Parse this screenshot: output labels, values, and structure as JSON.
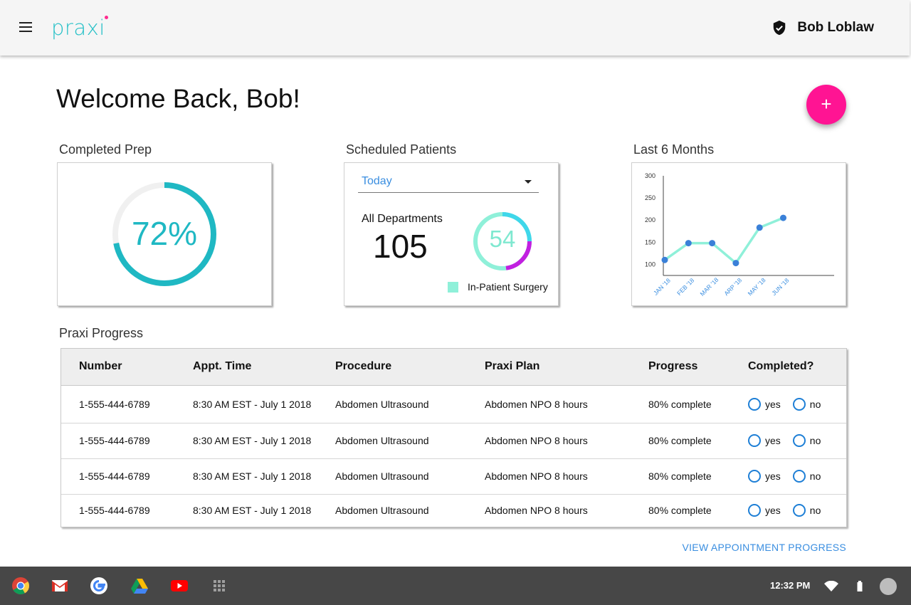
{
  "header": {
    "logo_text": "praxi",
    "user_name": "Bob Loblaw"
  },
  "welcome": {
    "title": "Welcome Back, Bob!"
  },
  "fab": {
    "label": "+"
  },
  "completed_prep": {
    "title": "Completed Prep",
    "value_label": "72%",
    "percent": 72,
    "color": "#1fb8c3"
  },
  "scheduled_patients": {
    "title": "Scheduled Patients",
    "period": "Today",
    "department_label": "All Departments",
    "department_count": "105",
    "ring_value": "54",
    "legend_label": "In-Patient Surgery",
    "colors": {
      "ring": "#8ff0d9",
      "accent_cyan": "#3fd7ea",
      "accent_purple": "#c21fe0"
    }
  },
  "last_months": {
    "title": "Last 6 Months"
  },
  "chart_data": {
    "type": "line",
    "categories": [
      "JAN '18",
      "FEB '18",
      "MAR '18",
      "ARP '18",
      "MAY '18",
      "JUN '18"
    ],
    "values": [
      110,
      148,
      148,
      103,
      183,
      205
    ],
    "ylim": [
      75,
      300
    ],
    "yticks": [
      "300",
      "250",
      "200",
      "150",
      "100"
    ],
    "title": "",
    "xlabel": "",
    "ylabel": "",
    "grid": false,
    "line_color": "#8ff0d9",
    "point_color": "#3a80d8"
  },
  "progress": {
    "title": "Praxi Progress",
    "columns": [
      "Number",
      "Appt. Time",
      "Procedure",
      "Praxi Plan",
      "Progress",
      "Completed?"
    ],
    "rows": [
      {
        "number": "1-555-444-6789",
        "time": "8:30 AM EST - July 1 2018",
        "procedure": "Abdomen Ultrasound",
        "plan": "Abdomen NPO 8 hours",
        "progress": "80% complete",
        "yes": "yes",
        "no": "no"
      },
      {
        "number": "1-555-444-6789",
        "time": "8:30 AM EST - July 1 2018",
        "procedure": "Abdomen Ultrasound",
        "plan": "Abdomen NPO 8 hours",
        "progress": "80% complete",
        "yes": "yes",
        "no": "no"
      },
      {
        "number": "1-555-444-6789",
        "time": "8:30 AM EST - July 1 2018",
        "procedure": "Abdomen Ultrasound",
        "plan": "Abdomen NPO 8 hours",
        "progress": "80% complete",
        "yes": "yes",
        "no": "no"
      },
      {
        "number": "1-555-444-6789",
        "time": "8:30 AM EST - July 1 2018",
        "procedure": "Abdomen Ultrasound",
        "plan": "Abdomen NPO 8 hours",
        "progress": "80% complete",
        "yes": "yes",
        "no": "no"
      }
    ],
    "link_label": "VIEW APPOINTMENT PROGRESS"
  },
  "shelf": {
    "apps": [
      "chrome-icon",
      "gmail-icon",
      "google-icon",
      "drive-icon",
      "youtube-icon",
      "app-launcher-icon"
    ],
    "time": "12:32 PM"
  }
}
